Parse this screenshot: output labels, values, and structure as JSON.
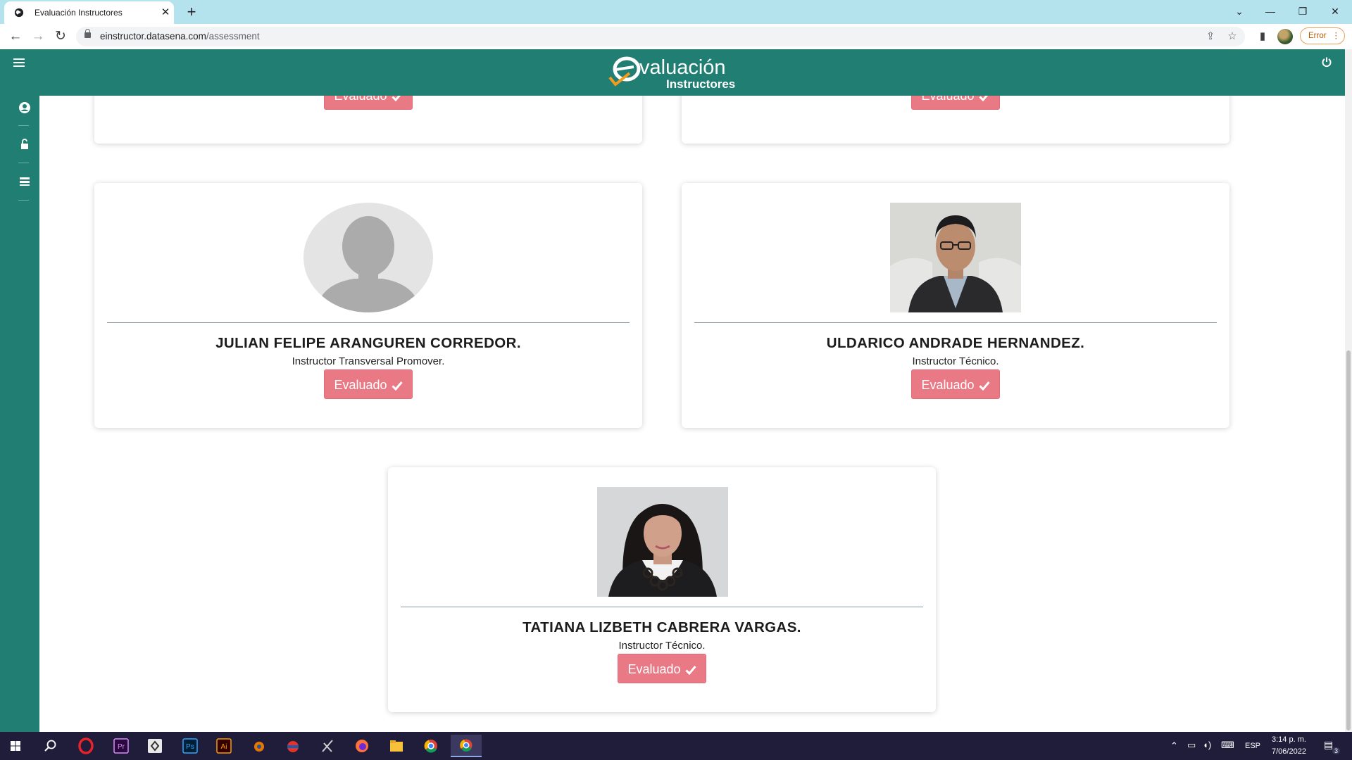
{
  "browser": {
    "tab_title": "Evaluación Instructores",
    "tab_close": "✕",
    "new_tab": "+",
    "url_domain": "einstructor.datasena.com",
    "url_path": "/assessment",
    "error_label": "Error",
    "window_controls": [
      "⌄",
      "—",
      "❐",
      "✕"
    ]
  },
  "app": {
    "logo_line1": "valuación",
    "logo_line2": "Instructores"
  },
  "instructors": [
    {
      "name": "JULIAN FELIPE ARANGUREN CORREDOR.",
      "role": "Instructor Transversal Promover.",
      "button": "Evaluado",
      "photo": "default-avatar"
    },
    {
      "name": "ULDARICO ANDRADE HERNANDEZ.",
      "role": "Instructor Técnico.",
      "button": "Evaluado",
      "photo": "man-with-glasses"
    },
    {
      "name": "TATIANA LIZBETH CABRERA VARGAS.",
      "role": "Instructor Técnico.",
      "button": "Evaluado",
      "photo": "woman-with-necklace"
    }
  ],
  "partial_cards": [
    {
      "button": "Evaluado"
    },
    {
      "button": "Evaluado"
    }
  ],
  "taskbar": {
    "language": "ESP",
    "time": "3:14 p. m.",
    "date": "7/06/2022",
    "notification_count": "3",
    "apps": [
      "windows-start-icon",
      "search-icon",
      "opera-icon",
      "premiere-pro-icon",
      "unity-icon",
      "photoshop-icon",
      "illustrator-icon",
      "blender-icon",
      "app-icon",
      "inkscape-icon",
      "firefox-icon",
      "file-explorer-icon",
      "chrome-icon",
      "chrome-active-icon"
    ]
  },
  "colors": {
    "header": "#207e72",
    "button": "#e97985",
    "tabstrip": "#b4e3ee",
    "taskbar": "#1f1d3a"
  }
}
